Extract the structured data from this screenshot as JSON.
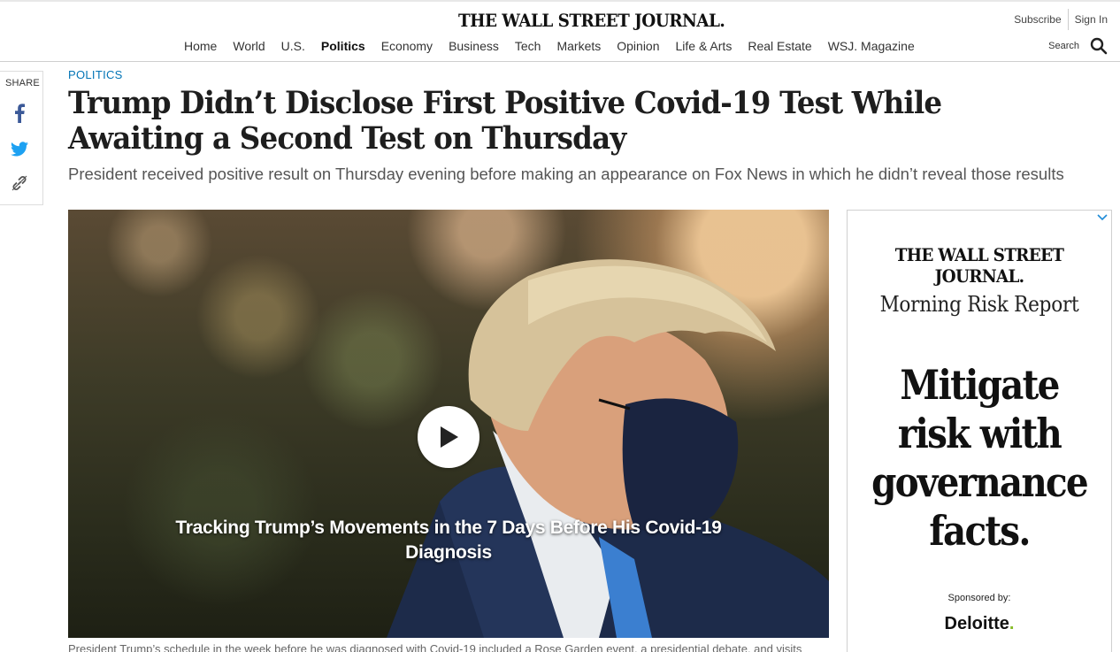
{
  "header": {
    "masthead": "THE WALL STREET JOURNAL.",
    "subscribe_label": "Subscribe",
    "signin_label": "Sign In",
    "search_label": "Search",
    "nav": [
      {
        "label": "Home"
      },
      {
        "label": "World"
      },
      {
        "label": "U.S."
      },
      {
        "label": "Politics",
        "active": true
      },
      {
        "label": "Economy"
      },
      {
        "label": "Business"
      },
      {
        "label": "Tech"
      },
      {
        "label": "Markets"
      },
      {
        "label": "Opinion"
      },
      {
        "label": "Life & Arts"
      },
      {
        "label": "Real Estate"
      },
      {
        "label": "WSJ. Magazine"
      }
    ]
  },
  "share": {
    "label": "SHARE",
    "icons": [
      "facebook-icon",
      "twitter-icon",
      "link-icon"
    ]
  },
  "article": {
    "kicker": "POLITICS",
    "headline": "Trump Didn’t Disclose First Positive Covid-19 Test While Awaiting a Second Test on Thursday",
    "dek": "President received positive result on Thursday evening before making an appearance on Fox News in which he didn’t reveal those results",
    "video": {
      "title": "Tracking Trump’s Movements in the 7 Days Before His Covid-19 Diagnosis"
    },
    "caption": "President Trump’s schedule in the week before he was diagnosed with Covid-19 included a Rose Garden event, a presidential debate, and visits"
  },
  "ad": {
    "masthead": "THE WALL STREET JOURNAL.",
    "report": "Morning Risk Report",
    "headline_lines": [
      "Mitigate",
      "risk with",
      "governance",
      "facts."
    ],
    "sponsor_label": "Sponsored by:",
    "brand": "Deloitte",
    "brand_dot": ".",
    "brand_dot_color": "#86bc25"
  },
  "colors": {
    "kicker": "#0274b6",
    "facebook": "#3b5998",
    "twitter": "#1da1f2"
  }
}
